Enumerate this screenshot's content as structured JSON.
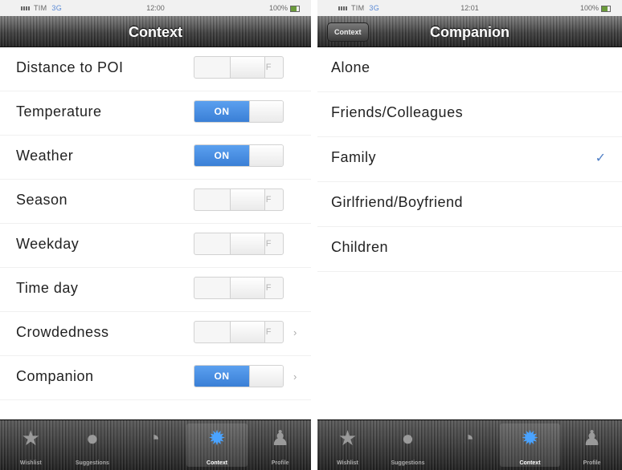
{
  "left": {
    "status": {
      "carrier": "TIM",
      "network": "3G",
      "time": "12:00",
      "battery": "100%"
    },
    "navbar": {
      "title": "Context"
    },
    "settings": [
      {
        "label": "Distance to POI",
        "state": "OFF",
        "on": false,
        "chevron": false
      },
      {
        "label": "Temperature",
        "state": "ON",
        "on": true,
        "chevron": false
      },
      {
        "label": "Weather",
        "state": "ON",
        "on": true,
        "chevron": false
      },
      {
        "label": "Season",
        "state": "OFF",
        "on": false,
        "chevron": false
      },
      {
        "label": "Weekday",
        "state": "OFF",
        "on": false,
        "chevron": false
      },
      {
        "label": "Time day",
        "state": "OFF",
        "on": false,
        "chevron": false
      },
      {
        "label": "Crowdedness",
        "state": "OFF",
        "on": false,
        "chevron": true
      },
      {
        "label": "Companion",
        "state": "ON",
        "on": true,
        "chevron": true
      }
    ],
    "chevron_glyph": "›",
    "tabs": [
      {
        "icon": "star-icon",
        "glyph": "★",
        "label": "Wishlist",
        "active": false
      },
      {
        "icon": "globe-icon",
        "glyph": "●",
        "label": "Suggestions",
        "active": false
      },
      {
        "icon": "clock-icon",
        "glyph": "◔",
        "label": "",
        "active": false
      },
      {
        "icon": "gear-icon",
        "glyph": "✹",
        "label": "Context",
        "active": true
      },
      {
        "icon": "profile-icon",
        "glyph": "♟",
        "label": "Profile",
        "active": false
      }
    ]
  },
  "right": {
    "status": {
      "carrier": "TIM",
      "network": "3G",
      "time": "12:01",
      "battery": "100%"
    },
    "navbar": {
      "title": "Companion",
      "back": "Context"
    },
    "options": [
      {
        "label": "Alone",
        "checked": false
      },
      {
        "label": "Friends/Colleagues",
        "checked": false
      },
      {
        "label": "Family",
        "checked": true
      },
      {
        "label": "Girlfriend/Boyfriend",
        "checked": false
      },
      {
        "label": "Children",
        "checked": false
      }
    ],
    "check_glyph": "✓",
    "tabs": [
      {
        "icon": "star-icon",
        "glyph": "★",
        "label": "Wishlist",
        "active": false
      },
      {
        "icon": "globe-icon",
        "glyph": "●",
        "label": "Suggestions",
        "active": false
      },
      {
        "icon": "clock-icon",
        "glyph": "◔",
        "label": "",
        "active": false
      },
      {
        "icon": "gear-icon",
        "glyph": "✹",
        "label": "Context",
        "active": true
      },
      {
        "icon": "profile-icon",
        "glyph": "♟",
        "label": "Profile",
        "active": false
      }
    ]
  },
  "colors": {
    "accent": "#3a7fd6",
    "check": "#4f7fc6",
    "active_tab_icon": "#4aa3ff"
  }
}
